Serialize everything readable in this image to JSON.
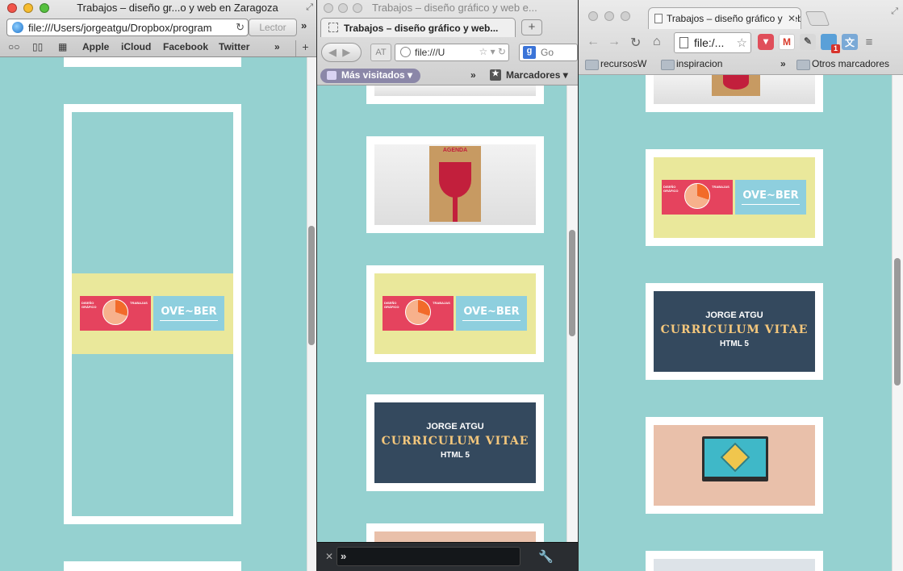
{
  "safari": {
    "title": "Trabajos – diseño gr...o y web en Zaragoza",
    "url": "file:///Users/jorgeatgu/Dropbox/program",
    "reader_label": "Lector",
    "overflow": "»",
    "bookmarks": [
      "Apple",
      "iCloud",
      "Facebook",
      "Twitter"
    ],
    "bookmarks_more": "»",
    "add_button": "+"
  },
  "firefox": {
    "title": "Trabajos – diseño gráfico y web e...",
    "tab_label": "Trabajos – diseño gráfico y web...",
    "new_tab": "+",
    "url": "file:///U",
    "reader_label": "AT",
    "search_text": "Go",
    "search_engine": "g",
    "most_visited": "Más visitados",
    "bookmarks_more": "»",
    "bookmarks_label": "Marcadores",
    "devtools_prompt": "»"
  },
  "chrome": {
    "tab_label": "Trabajos – diseño gráfico y web",
    "url": "file:/...",
    "bookmarks": [
      "recursosW",
      "inspiracion"
    ],
    "bookmarks_more": "»",
    "other_bookmarks": "Otros marcadores",
    "extension_badge": "1"
  },
  "thumbnails": {
    "poster_title": "AGENDA",
    "overmustache": {
      "left_text": "DISEÑO GRÁFICO",
      "left_sub": "TRABAJAS",
      "word": "OVE~BER"
    },
    "cv": {
      "name": "JORGE ATGU",
      "title": "CURRICULUM VITAE",
      "subtitle": "HTML 5"
    }
  },
  "colors": {
    "page_bg": "#95d1d0",
    "navy": "#34495e",
    "yellow": "#eae89b",
    "peach": "#e9c0aa",
    "red": "#e5435e",
    "accent_gold": "#f4c77c"
  }
}
